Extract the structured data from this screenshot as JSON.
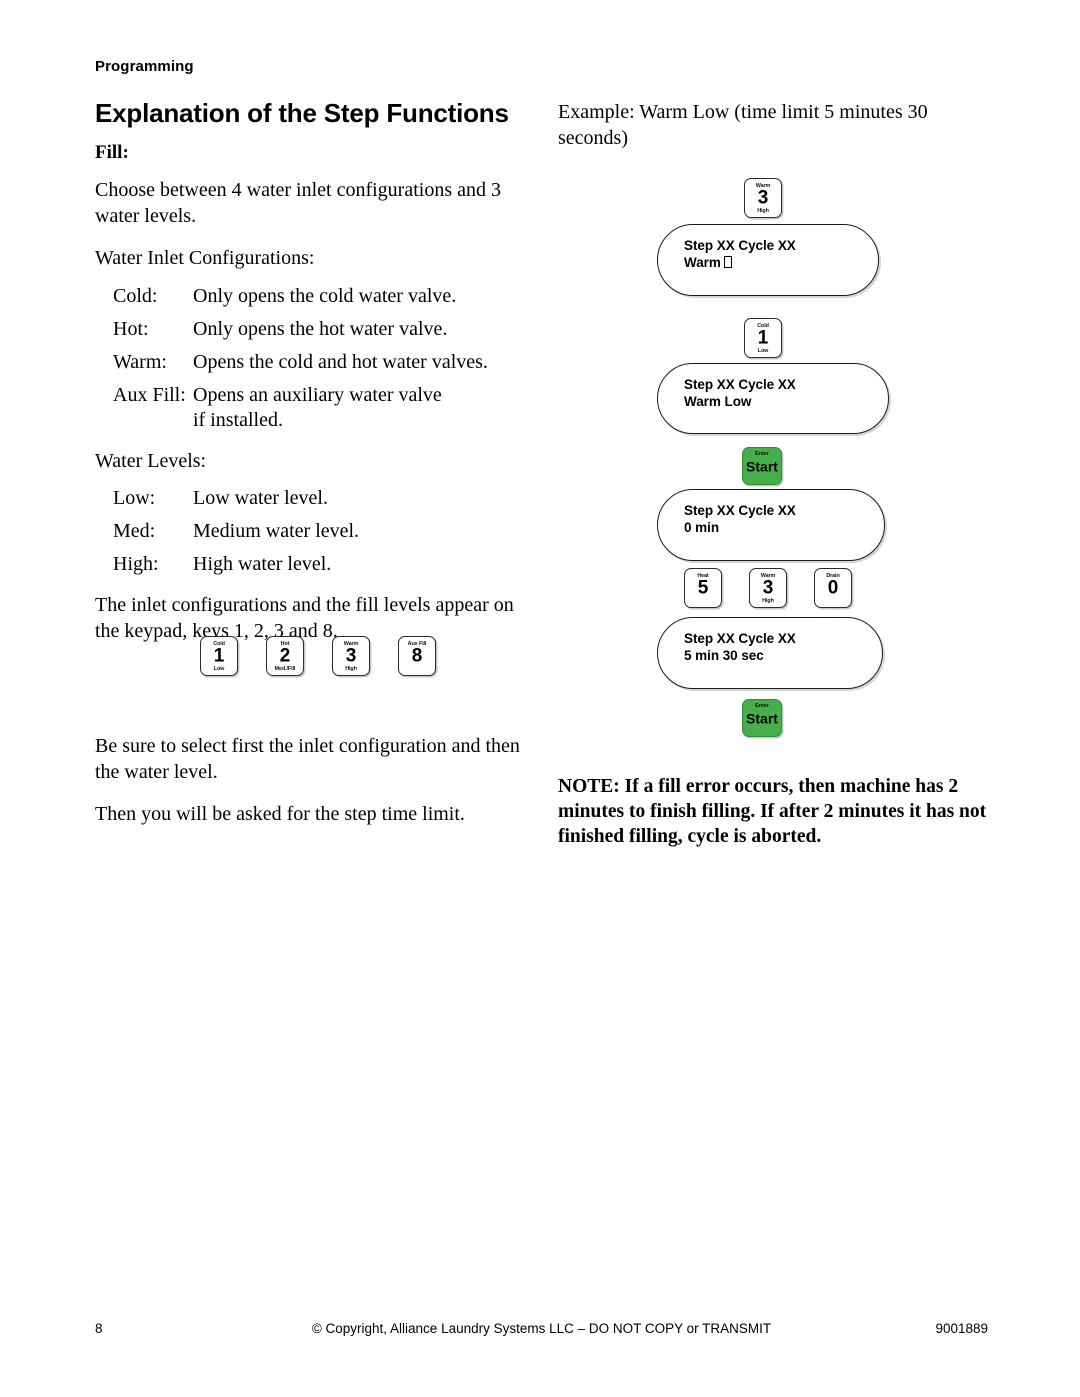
{
  "header": {
    "running_head": "Programming"
  },
  "left": {
    "title": "Explanation of the Step Functions",
    "subtitle": "Fill:",
    "intro": "Choose between 4 water inlet configurations and 3 water levels.",
    "inlet_heading": "Water Inlet Configurations:",
    "inlet_items": [
      {
        "term": "Cold:",
        "desc": "Only opens the cold water valve."
      },
      {
        "term": "Hot:",
        "desc": "Only opens the hot water valve."
      },
      {
        "term": "Warm:",
        "desc": "Opens the cold and hot water valves."
      },
      {
        "term": "Aux Fill:",
        "desc": "Opens an auxiliary water valve",
        "desc2": "if installed."
      }
    ],
    "levels_heading": "Water Levels:",
    "level_items": [
      {
        "term": "Low:",
        "desc": "Low water level."
      },
      {
        "term": "Med:",
        "desc": "Medium water level."
      },
      {
        "term": "High:",
        "desc": "High water level."
      }
    ],
    "keypad_note": "The inlet configurations and the fill levels appear on the keypad, keys 1, 2, 3 and 8.",
    "keypad_keys": [
      {
        "top": "Cold",
        "num": "1",
        "bottom": "Low"
      },
      {
        "top": "Hot",
        "num": "2",
        "bottom": "Med./Fill"
      },
      {
        "top": "Warm",
        "num": "3",
        "bottom": "High"
      },
      {
        "top": "Aux Fill",
        "num": "8",
        "bottom": ""
      }
    ],
    "closing_1": "Be sure to select first the inlet configuration and then the water level.",
    "closing_2": "Then you will be asked for the step time limit."
  },
  "right": {
    "example_intro": "Example: Warm Low (time limit 5 minutes 30 seconds)",
    "step1_key": {
      "top": "Warm",
      "num": "3",
      "bottom": "High"
    },
    "display1": {
      "line1": "Step XX Cycle XX",
      "line2": "Warm",
      "cursor": true
    },
    "step2_key": {
      "top": "Cold",
      "num": "1",
      "bottom": "Low"
    },
    "display2": {
      "line1": "Step XX Cycle XX",
      "line2": "Warm Low",
      "cursor": false
    },
    "start1": {
      "top": "Enter",
      "label": "Start"
    },
    "display3": {
      "line1": "Step XX Cycle XX",
      "line2": "0 min",
      "cursor": false
    },
    "time_keys": [
      {
        "top": "Heat",
        "num": "5",
        "bottom": ""
      },
      {
        "top": "Warm",
        "num": "3",
        "bottom": "High"
      },
      {
        "top": "Drain",
        "num": "0",
        "bottom": ""
      }
    ],
    "display4": {
      "line1": "Step XX Cycle XX",
      "line2": "5 min 30 sec",
      "cursor": false
    },
    "start2": {
      "top": "Enter",
      "label": "Start"
    },
    "note": "NOTE: If a fill error occurs, then machine has 2 minutes to finish filling. If after 2 minutes it has not finished filling, cycle is aborted."
  },
  "footer": {
    "page_number": "8",
    "copyright": "© Copyright, Alliance Laundry Systems LLC – DO NOT COPY or TRANSMIT",
    "doc_number": "9001889"
  },
  "colors": {
    "start_button_green": "#46af4b",
    "text_black": "#000000",
    "outline": "#1b1b1b"
  }
}
